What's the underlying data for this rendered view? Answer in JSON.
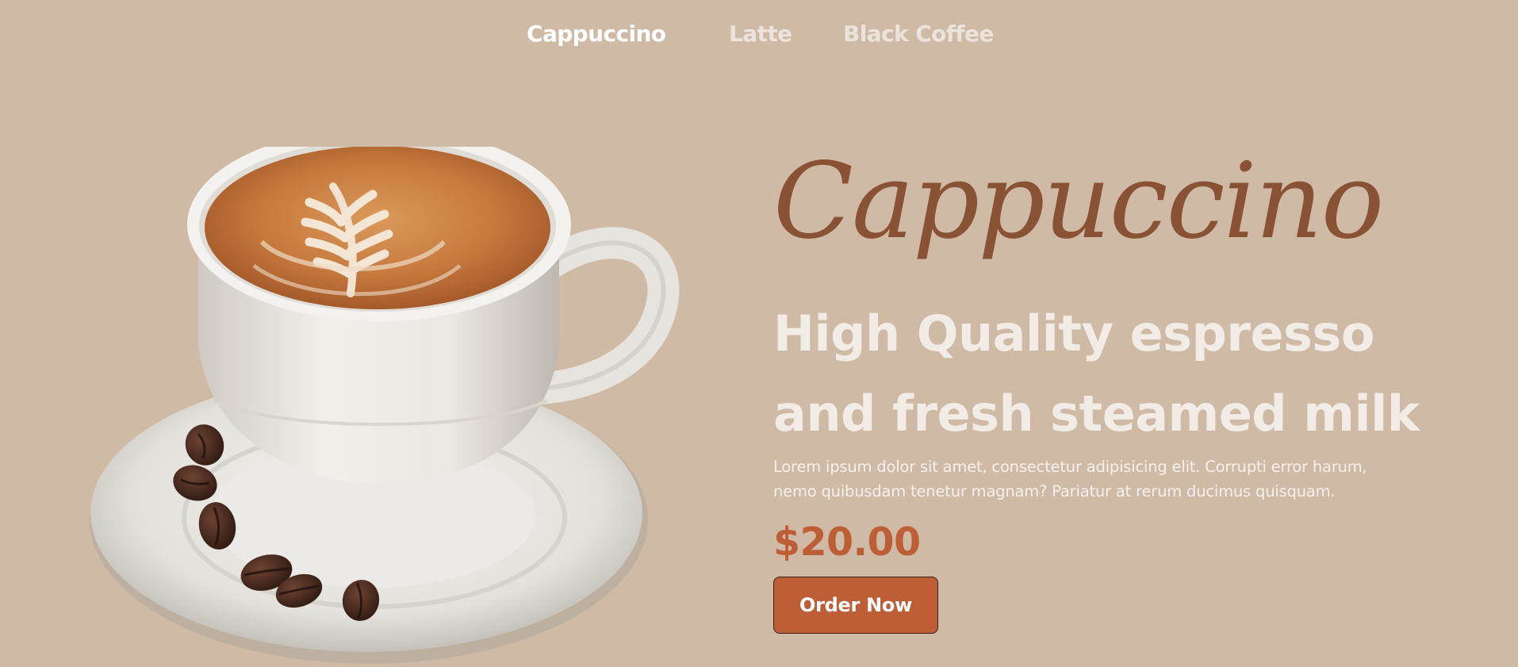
{
  "nav": {
    "items": [
      {
        "label": "Cappuccino",
        "active": true
      },
      {
        "label": "Latte",
        "active": false
      },
      {
        "label": "Black Coffee",
        "active": false
      }
    ]
  },
  "hero": {
    "script_title": "Cappuccino",
    "headline_line1": "High Quality espresso",
    "headline_line2": "and fresh steamed milk",
    "description_line1": "Lorem ipsum dolor sit amet, consectetur adipisicing elit. Corrupti error harum,",
    "description_line2": "nemo quibusdam tenetur magnam? Pariatur at rerum ducimus quisquam.",
    "price": "$20.00",
    "order_button_label": "Order Now",
    "image_icon": "cappuccino-cup-image"
  },
  "colors": {
    "background": "#cfbaa6",
    "accent": "#bd5e36",
    "script_title": "#8a5234",
    "headline": "#f2ece7"
  }
}
